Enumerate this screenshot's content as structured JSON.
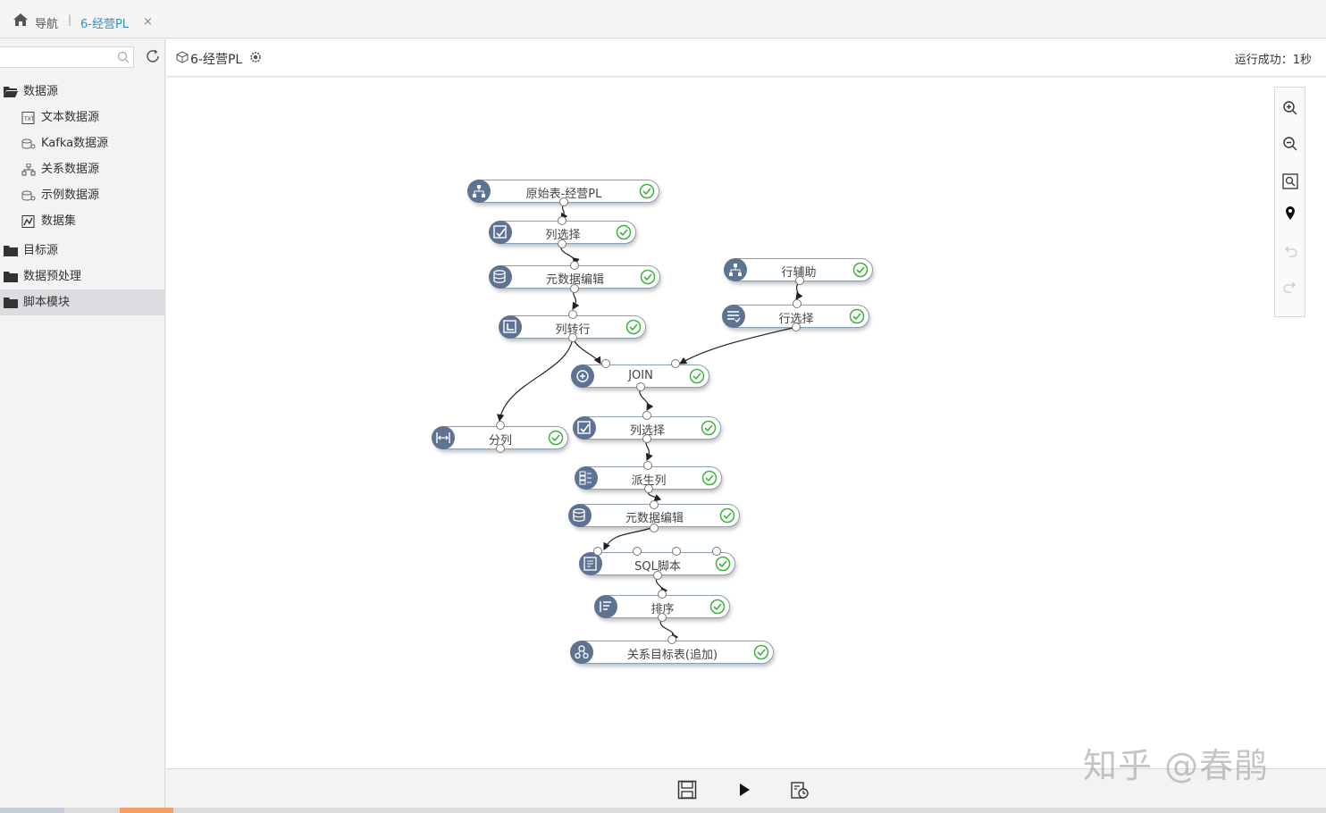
{
  "topbar": {
    "nav_label": "导航",
    "separator": "|",
    "active_tab": "6-经营PL",
    "close_glyph": "×"
  },
  "sidebar": {
    "search_placeholder": "",
    "tree": [
      {
        "label": "数据源",
        "type": "folder",
        "icon": "folder-open-icon"
      },
      {
        "label": "文本数据源",
        "type": "child",
        "icon": "text-file-icon"
      },
      {
        "label": "Kafka数据源",
        "type": "child",
        "icon": "kafka-icon"
      },
      {
        "label": "关系数据源",
        "type": "child",
        "icon": "relational-db-icon"
      },
      {
        "label": "示例数据源",
        "type": "child",
        "icon": "sample-db-icon"
      },
      {
        "label": "数据集",
        "type": "child",
        "icon": "dataset-icon"
      },
      {
        "label": "目标源",
        "type": "folder",
        "icon": "folder-icon"
      },
      {
        "label": "数据预处理",
        "type": "folder",
        "icon": "folder-icon"
      },
      {
        "label": "脚本模块",
        "type": "folder",
        "icon": "folder-icon",
        "selected": true
      }
    ]
  },
  "header": {
    "flow_title": "6-经营PL",
    "status_text": "运行成功：1秒"
  },
  "nodes": {
    "n1": "原始表-经营PL",
    "n2": "列选择",
    "n3": "元数据编辑",
    "n4": "列转行",
    "n5": "行辅助",
    "n6": "行选择",
    "n7": "JOIN",
    "n8": "分列",
    "n9": "列选择",
    "n10": "派生列",
    "n11": "元数据编辑",
    "n12": "SQL脚本",
    "n13": "排序",
    "n14": "关系目标表(追加)"
  },
  "node_status": "success",
  "colors": {
    "accent": "#2f8fc9",
    "node_icon_bg": "#5d7391",
    "success": "#3cb43c"
  },
  "zoom_tools": [
    "zoom-in-icon",
    "zoom-out-icon",
    "fit-view-icon",
    "locate-pin-icon",
    "undo-icon",
    "redo-icon"
  ],
  "bottom_tools": [
    "save-icon",
    "run-icon",
    "schedule-icon"
  ],
  "watermark": "知乎 @春鹃"
}
